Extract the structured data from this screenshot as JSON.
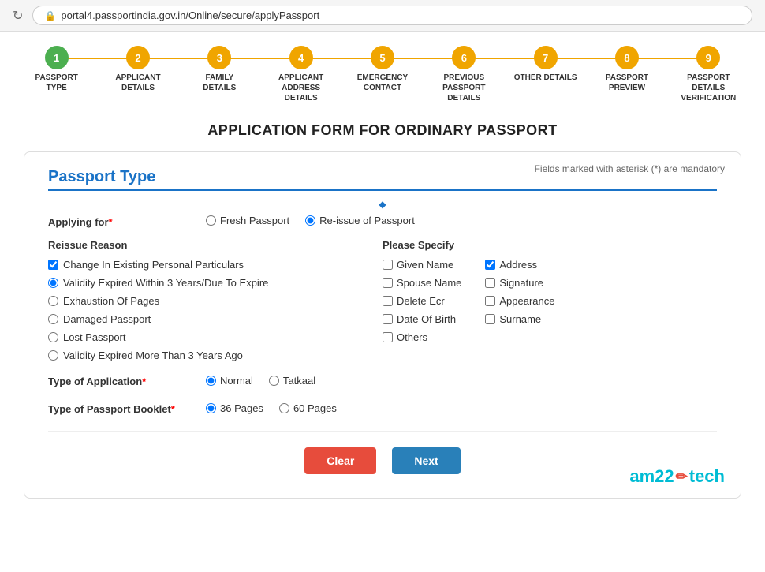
{
  "browser": {
    "url": "portal4.passportindia.gov.in/Online/secure/applyPassport",
    "refresh_icon": "↻",
    "lock_icon": "🔒"
  },
  "stepper": {
    "steps": [
      {
        "number": "1",
        "label": "PASSPORT TYPE",
        "state": "completed"
      },
      {
        "number": "2",
        "label": "APPLICANT DETAILS",
        "state": "active"
      },
      {
        "number": "3",
        "label": "FAMILY DETAILS",
        "state": "active"
      },
      {
        "number": "4",
        "label": "APPLICANT ADDRESS DETAILS",
        "state": "active"
      },
      {
        "number": "5",
        "label": "EMERGENCY CONTACT",
        "state": "active"
      },
      {
        "number": "6",
        "label": "PREVIOUS PASSPORT DETAILS",
        "state": "active"
      },
      {
        "number": "7",
        "label": "OTHER DETAILS",
        "state": "active"
      },
      {
        "number": "8",
        "label": "PASSPORT PREVIEW",
        "state": "active"
      },
      {
        "number": "9",
        "label": "PASSPORT DETAILS VERIFICATION",
        "state": "active"
      }
    ]
  },
  "page_title": "APPLICATION FORM FOR ORDINARY PASSPORT",
  "form": {
    "mandatory_note": "Fields marked with asterisk (*) are mandatory",
    "section_title": "Passport Type",
    "applying_for_label": "Applying for",
    "applying_for_required": "*",
    "applying_for_options": [
      {
        "id": "fresh",
        "label": "Fresh Passport",
        "checked": false
      },
      {
        "id": "reissue",
        "label": "Re-issue of Passport",
        "checked": true
      }
    ],
    "reissue_reason_title": "Reissue Reason",
    "reissue_reasons": [
      {
        "id": "change",
        "label": "Change In Existing Personal Particulars",
        "checked": true,
        "type": "checkbox"
      },
      {
        "id": "validity3",
        "label": "Validity Expired Within 3 Years/Due To Expire",
        "checked": true,
        "type": "radio"
      },
      {
        "id": "exhaustion",
        "label": "Exhaustion Of Pages",
        "checked": false,
        "type": "radio"
      },
      {
        "id": "damaged",
        "label": "Damaged Passport",
        "checked": false,
        "type": "radio"
      },
      {
        "id": "lost",
        "label": "Lost Passport",
        "checked": false,
        "type": "radio"
      },
      {
        "id": "validity_more",
        "label": "Validity Expired More Than 3 Years Ago",
        "checked": false,
        "type": "radio"
      }
    ],
    "please_specify_title": "Please Specify",
    "please_specify_col1": [
      {
        "id": "given_name",
        "label": "Given Name",
        "checked": false
      },
      {
        "id": "spouse_name",
        "label": "Spouse Name",
        "checked": false
      },
      {
        "id": "delete_ecr",
        "label": "Delete Ecr",
        "checked": false
      },
      {
        "id": "date_of_birth",
        "label": "Date Of Birth",
        "checked": false
      },
      {
        "id": "others",
        "label": "Others",
        "checked": false
      }
    ],
    "please_specify_col2": [
      {
        "id": "address",
        "label": "Address",
        "checked": true
      },
      {
        "id": "signature",
        "label": "Signature",
        "checked": false
      },
      {
        "id": "appearance",
        "label": "Appearance",
        "checked": false
      },
      {
        "id": "surname",
        "label": "Surname",
        "checked": false
      }
    ],
    "type_application_label": "Type of Application",
    "type_application_required": "*",
    "type_application_options": [
      {
        "id": "normal",
        "label": "Normal",
        "checked": true
      },
      {
        "id": "tatkaal",
        "label": "Tatkaal",
        "checked": false
      }
    ],
    "type_booklet_label": "Type of Passport Booklet",
    "type_booklet_required": "*",
    "type_booklet_options": [
      {
        "id": "pages36",
        "label": "36 Pages",
        "checked": true
      },
      {
        "id": "pages60",
        "label": "60 Pages",
        "checked": false
      }
    ],
    "buttons": {
      "clear": "Clear",
      "next": "Next"
    }
  },
  "branding": {
    "text_left": "am22",
    "pencil": "✏",
    "text_right": "tech"
  }
}
